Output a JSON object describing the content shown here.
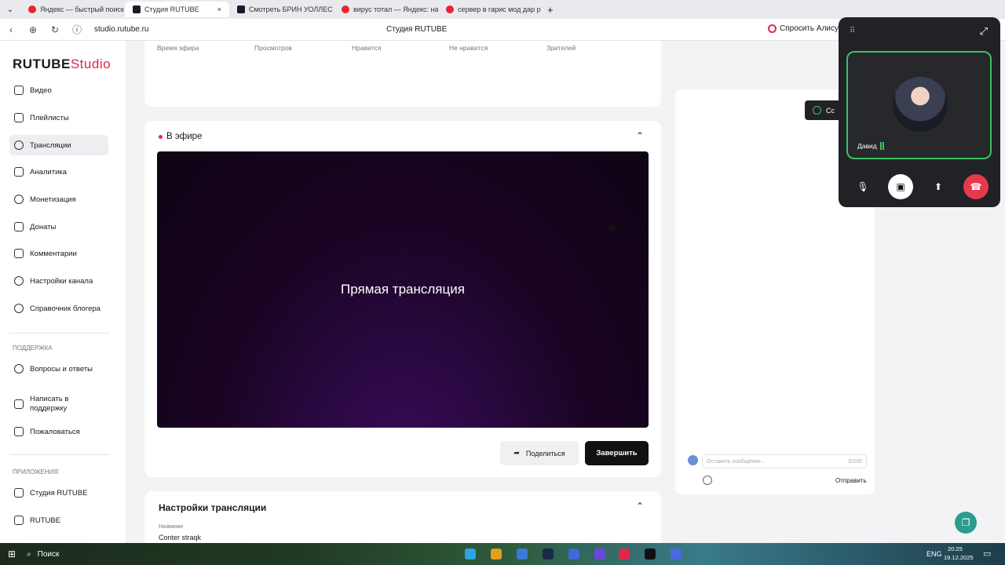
{
  "browser": {
    "tabs": [
      {
        "label": "Яндекс — быстрый поиск"
      },
      {
        "label": "Студия RUTUBE"
      },
      {
        "label": "Смотреть БРИН УОЛЛЕС"
      },
      {
        "label": "вирус тотал — Яндекс: на"
      },
      {
        "label": "сервер в гарис мод дар р"
      }
    ],
    "url": "studio.rutube.ru",
    "page_title": "Студия RUTUBE",
    "alice": "Спросить Алису"
  },
  "logo": {
    "brand": "RUTUBE",
    "studio": "Studio"
  },
  "sidebar": {
    "items": [
      {
        "label": "Видео"
      },
      {
        "label": "Плейлисты"
      },
      {
        "label": "Трансляции"
      },
      {
        "label": "Аналитика"
      },
      {
        "label": "Монетизация"
      },
      {
        "label": "Донаты"
      },
      {
        "label": "Комментарии"
      },
      {
        "label": "Настройки канала"
      },
      {
        "label": "Справочник блогера"
      }
    ],
    "support_title": "ПОДДЕРЖКА",
    "support": [
      {
        "label": "Вопросы и ответы"
      },
      {
        "label": "Написать в поддержку"
      },
      {
        "label": "Пожаловаться"
      }
    ],
    "apps_title": "ПРИЛОЖЕНИЯ",
    "apps": [
      {
        "label": "Студия RUTUBE"
      },
      {
        "label": "RUTUBE"
      }
    ]
  },
  "stats_header": [
    "Время эфира",
    "Просмотров",
    "Нравится",
    "Не нравится",
    "Зрителей"
  ],
  "live": {
    "title": "В эфире",
    "player_text": "Прямая трансляция",
    "share": "Поделиться",
    "finish": "Завершить"
  },
  "settings": {
    "title": "Настройки трансляции",
    "name_label": "Название",
    "name_value": "Conter straqk"
  },
  "chat": {
    "placeholder": "Оставить сообщение...",
    "counter": "0/200",
    "send": "Отправить"
  },
  "toast": {
    "text": "Сс"
  },
  "call": {
    "user": "Давид"
  },
  "taskbar": {
    "search": "Поиск",
    "lang": "ENG",
    "time": "20:25",
    "date": "19.12.2025"
  },
  "colors": {
    "accent": "#e0284b",
    "call_green": "#3cc160",
    "hangup": "#e5394c"
  }
}
